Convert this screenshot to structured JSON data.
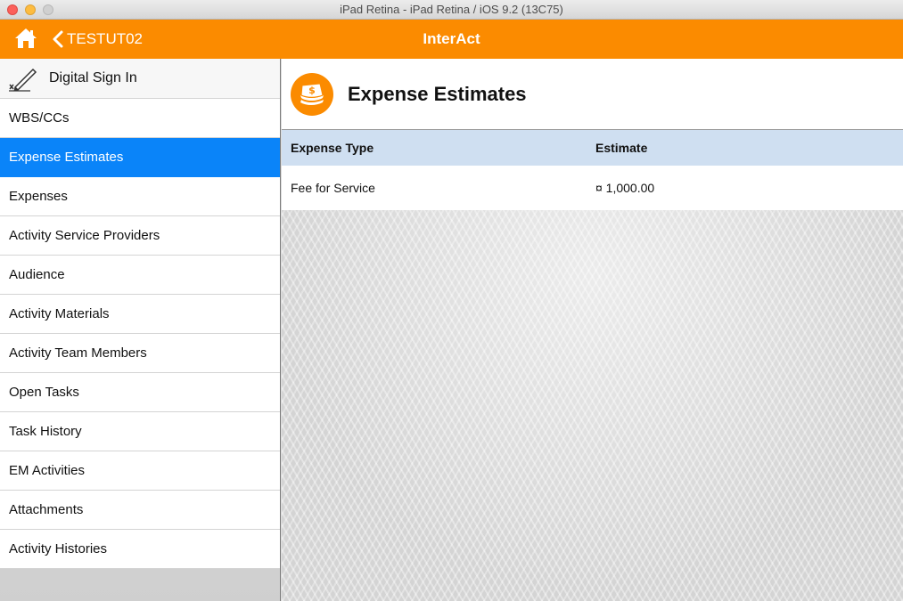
{
  "window": {
    "title": "iPad Retina - iPad Retina / iOS 9.2 (13C75)"
  },
  "navbar": {
    "home_icon": "home-icon",
    "back_label": "TESTUT02",
    "title": "InterAct",
    "color": "#fb8b00"
  },
  "sidebar": {
    "sign_in": {
      "label": "Digital Sign In",
      "icon": "signature-icon"
    },
    "items": [
      {
        "label": "WBS/CCs",
        "selected": false
      },
      {
        "label": "Expense Estimates",
        "selected": true
      },
      {
        "label": "Expenses",
        "selected": false
      },
      {
        "label": "Activity Service Providers",
        "selected": false
      },
      {
        "label": "Audience",
        "selected": false
      },
      {
        "label": "Activity Materials",
        "selected": false
      },
      {
        "label": "Activity Team Members",
        "selected": false
      },
      {
        "label": "Open Tasks",
        "selected": false
      },
      {
        "label": "Task History",
        "selected": false
      },
      {
        "label": "EM Activities",
        "selected": false
      },
      {
        "label": "Attachments",
        "selected": false
      },
      {
        "label": "Activity Histories",
        "selected": false
      }
    ],
    "selected_color": "#0a84f9"
  },
  "main": {
    "icon": "money-icon",
    "title": "Expense Estimates",
    "table": {
      "columns": [
        "Expense Type",
        "Estimate"
      ],
      "rows": [
        [
          "Fee for Service",
          "¤ 1,000.00"
        ]
      ]
    }
  }
}
